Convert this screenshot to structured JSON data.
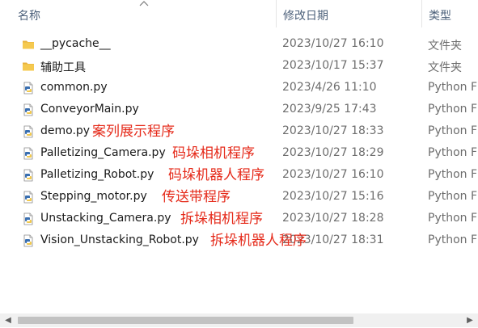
{
  "columns": {
    "name": "名称",
    "date": "修改日期",
    "type": "类型"
  },
  "files": [
    {
      "icon": "folder-icon",
      "name": "__pycache__",
      "date": "2023/10/27 16:10",
      "type": "文件夹",
      "note": ""
    },
    {
      "icon": "folder-icon",
      "name": "辅助工具",
      "date": "2023/10/17 15:37",
      "type": "文件夹",
      "note": ""
    },
    {
      "icon": "python-file-icon",
      "name": "common.py",
      "date": "2023/4/26 11:10",
      "type": "Python F",
      "note": ""
    },
    {
      "icon": "python-file-icon",
      "name": "ConveyorMain.py",
      "date": "2023/9/25 17:43",
      "type": "Python F",
      "note": ""
    },
    {
      "icon": "python-file-icon",
      "name": "demo.py",
      "date": "2023/10/27 18:33",
      "type": "Python F",
      "note": "案列展示程序"
    },
    {
      "icon": "python-file-icon",
      "name": "Palletizing_Camera.py",
      "date": "2023/10/27 18:29",
      "type": "Python F",
      "note": "码垛相机程序"
    },
    {
      "icon": "python-file-icon",
      "name": "Palletizing_Robot.py",
      "date": "2023/10/27 16:10",
      "type": "Python F",
      "note": "码垛机器人程序"
    },
    {
      "icon": "python-file-icon",
      "name": "Stepping_motor.py",
      "date": "2023/10/27 15:16",
      "type": "Python F",
      "note": "传送带程序"
    },
    {
      "icon": "python-file-icon",
      "name": "Unstacking_Camera.py",
      "date": "2023/10/27 18:28",
      "type": "Python F",
      "note": "拆垛相机程序"
    },
    {
      "icon": "python-file-icon",
      "name": "Vision_Unstacking_Robot.py",
      "date": "2023/10/27 18:31",
      "type": "Python F",
      "note": "拆垛机器人程序"
    }
  ],
  "colors": {
    "header_text": "#4c607a",
    "note": "#e52a1a",
    "folder": "#f3c34a",
    "python_blue": "#3a6fb0",
    "python_yellow": "#f2c94c"
  }
}
